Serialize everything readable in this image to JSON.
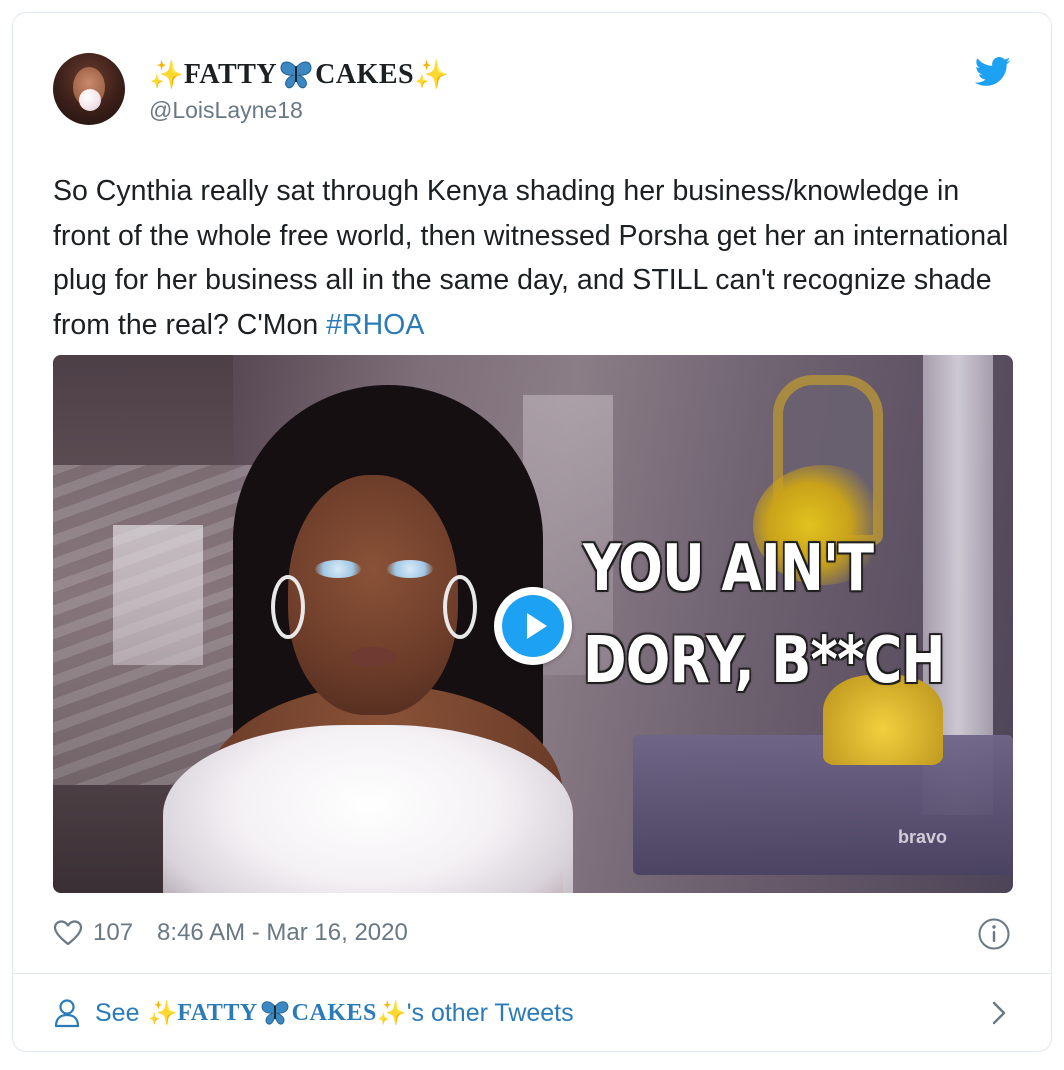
{
  "author": {
    "display_name_prefix": "✨",
    "display_name_part1": "FATTY",
    "display_name_emoji": "butterfly",
    "display_name_part2": "CAKES",
    "display_name_suffix": "✨",
    "handle": "@LoisLayne18"
  },
  "tweet": {
    "text": "So Cynthia really sat through Kenya shading her business/knowledge in front of the whole free world, then witnessed Porsha get her an international plug for her business all in the same day, and STILL can't recognize shade from the real? C'Mon ",
    "hashtag": "#RHOA"
  },
  "media": {
    "caption_line1": "YOU AIN'T",
    "caption_line2": "DORY, B**CH",
    "watermark": "bravo",
    "play_icon": "play-icon"
  },
  "meta": {
    "like_count": "107",
    "timestamp": "8:46 AM - Mar 16, 2020"
  },
  "footer": {
    "see_label": "See",
    "name_prefix": "✨",
    "name_part1": "FATTY",
    "name_part2": "CAKES",
    "name_suffix": "✨",
    "suffix_text": "'s other Tweets"
  },
  "colors": {
    "link": "#2b7bb9",
    "twitter_blue": "#1da1f2",
    "muted": "#697882",
    "sparkle": "#f5b83a",
    "butterfly": "#3b88c3"
  },
  "icons": [
    "twitter-bird-icon",
    "heart-icon",
    "info-icon",
    "person-icon",
    "chevron-right-icon",
    "butterfly-icon",
    "sparkle-icon",
    "play-icon"
  ]
}
